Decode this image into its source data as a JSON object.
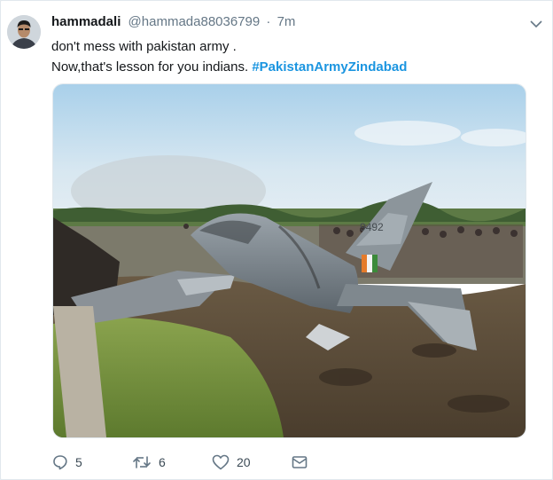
{
  "tweet": {
    "display_name": "hammadali",
    "handle": "@hammada88036799",
    "separator": "·",
    "time": "7m",
    "line1": "don't mess with pakistan army .",
    "line2_text": "Now,that's lesson for you indians.",
    "hashtag": "#PakistanArmyZindabad",
    "tail_number": "9492"
  },
  "actions": {
    "replies": "5",
    "retweets": "6",
    "likes": "20"
  },
  "icons": {
    "caret": "chevron-down-icon",
    "reply": "reply-icon",
    "retweet": "retweet-icon",
    "like": "heart-icon",
    "dm": "envelope-icon"
  },
  "colors": {
    "link": "#1b95e0",
    "secondary_text": "#657786",
    "card_bg": "#ffffff",
    "page_bg": "#e6ecf0"
  }
}
